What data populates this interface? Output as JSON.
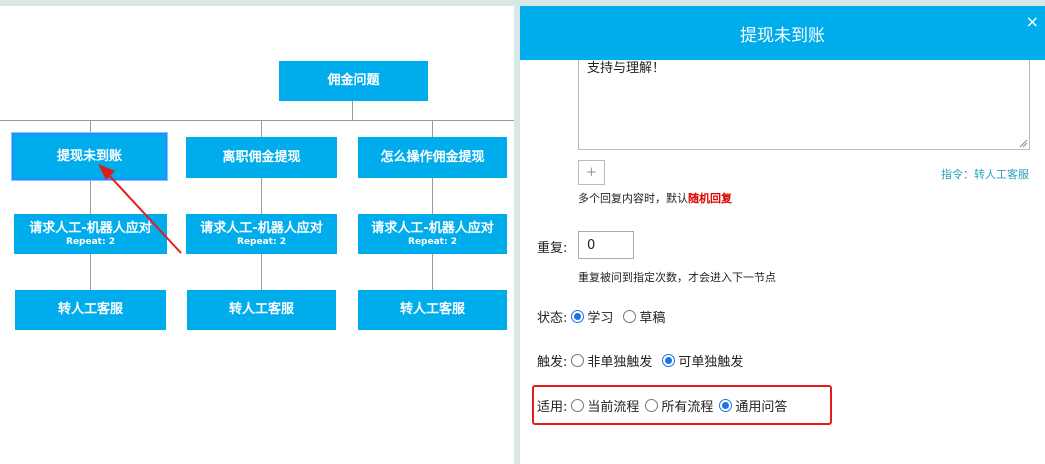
{
  "flow": {
    "root": {
      "label": "佣金问题"
    },
    "branches": [
      {
        "label": "提现未到账",
        "robot": {
          "label": "请求人工-机器人应对",
          "sub": "Repeat: 2"
        },
        "leaf": {
          "label": "转人工客服"
        }
      },
      {
        "label": "离职佣金提现",
        "robot": {
          "label": "请求人工-机器人应对",
          "sub": "Repeat: 2"
        },
        "leaf": {
          "label": "转人工客服"
        }
      },
      {
        "label": "怎么操作佣金提现",
        "robot": {
          "label": "请求人工-机器人应对",
          "sub": "Repeat: 2"
        },
        "leaf": {
          "label": "转人工客服"
        }
      }
    ]
  },
  "panel": {
    "title": "提现未到账",
    "close_icon": "×",
    "reply_text": "支持与理解！",
    "add_button": "+",
    "command_link": "指令：转人工客服",
    "hint_prefix": "多个回复内容时，默认",
    "hint_emphasis": "随机回复",
    "repeat": {
      "label": "重复:",
      "value": "0",
      "hint": "重复被问到指定次数，才会进入下一节点"
    },
    "status": {
      "label": "状态:",
      "options": [
        "学习",
        "草稿"
      ],
      "selected": "学习"
    },
    "trigger": {
      "label": "触发:",
      "options": [
        "非单独触发",
        "可单独触发"
      ],
      "selected": "可单独触发"
    },
    "apply": {
      "label": "适用:",
      "options": [
        "当前流程",
        "所有流程",
        "通用问答"
      ],
      "selected": "通用问答"
    }
  },
  "colors": {
    "accent": "#00adec",
    "highlight": "#e31b1b",
    "emphasis": "#e00000",
    "link": "#2a9fbd"
  }
}
